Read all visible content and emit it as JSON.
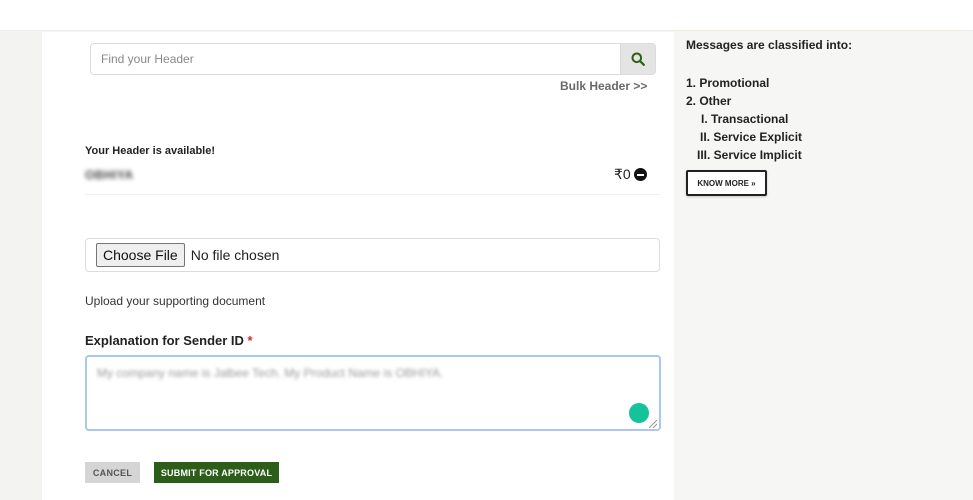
{
  "search": {
    "placeholder": "Find your Header",
    "icon": "search-icon",
    "bulk_link": "Bulk Header >>"
  },
  "availability": {
    "label": "Your Header is available!",
    "header_name": "OBHIYA",
    "price": "₹0",
    "remove_icon": "minus-circle-icon"
  },
  "file_upload": {
    "button_label": "Choose File",
    "status": "No file chosen",
    "help_text": "Upload your supporting document"
  },
  "explanation": {
    "label": "Explanation for Sender ID",
    "required_mark": "*",
    "placeholder": "My company name is Jalbee Tech. My Product Name is OBHIYA."
  },
  "actions": {
    "cancel_label": "CANCEL",
    "submit_label": "SUBMIT FOR APPROVAL"
  },
  "info_panel": {
    "title": "Messages are classified into:",
    "items": [
      {
        "label": "1. Promotional"
      },
      {
        "label": "2. Other"
      }
    ],
    "sub_items": [
      {
        "label": "I. Transactional"
      },
      {
        "label": "II. Service Explicit"
      },
      {
        "label": "III. Service Implicit"
      }
    ],
    "know_more_label": "KNOW MORE »"
  },
  "colors": {
    "submit_bg": "#2c5e1a",
    "cancel_bg": "#d5d5d5",
    "required": "#d9262c",
    "focus_border": "#a9c8ec",
    "grammarly": "#15c39a"
  }
}
